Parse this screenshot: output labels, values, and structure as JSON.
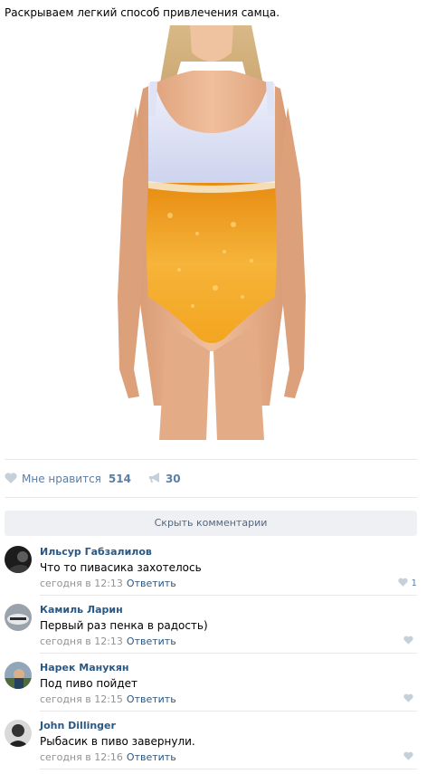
{
  "post": {
    "text": "Раскрываем легкий способ привлечения самца."
  },
  "actions": {
    "like_label": "Мне нравится",
    "like_count": "514",
    "repost_count": "30"
  },
  "hide_comments_label": "Скрыть комментарии",
  "comments": [
    {
      "author": "Ильсур Габзалилов",
      "text": "Что то пивасика захотелось",
      "time": "сегодня в 12:13",
      "reply": "Ответить",
      "likes": "1"
    },
    {
      "author": "Камиль Ларин",
      "text": "Первый раз пенка в радость)",
      "time": "сегодня в 12:13",
      "reply": "Ответить",
      "likes": ""
    },
    {
      "author": "Нарек Манукян",
      "text": "Под пиво пойдет",
      "time": "сегодня в 12:15",
      "reply": "Ответить",
      "likes": ""
    },
    {
      "author": "John Dillinger",
      "text": "Рыбасик в пиво завернули.",
      "time": "сегодня в 12:16",
      "reply": "Ответить",
      "likes": ""
    }
  ],
  "colors": {
    "link": "#2a5885",
    "muted": "#939393",
    "heart": "#c5d0db",
    "foam": "#d9ddf0",
    "beer": "#f0a020",
    "skin": "#e9b08c"
  }
}
